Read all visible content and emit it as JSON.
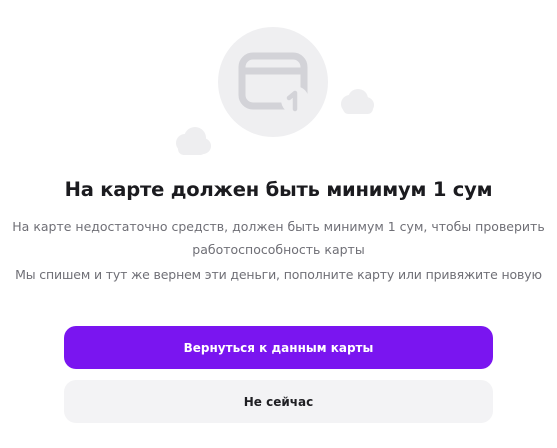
{
  "dialog": {
    "illustration_icon": "card-with-one-icon",
    "title": "На карте должен быть минимум 1 сум",
    "description_line1": "На карте недостаточно средств, должен быть минимум 1 сум, чтобы проверить работоспособность карты",
    "description_line2": "Мы спишем и тут же вернем эти деньги, пополните карту или привяжите новую",
    "primary_button": "Вернуться к данным карты",
    "secondary_button": "Не сейчас"
  },
  "colors": {
    "accent": "#7a15f0",
    "secondary_button_bg": "#f3f3f5",
    "illustration_bg": "#efeff1"
  }
}
